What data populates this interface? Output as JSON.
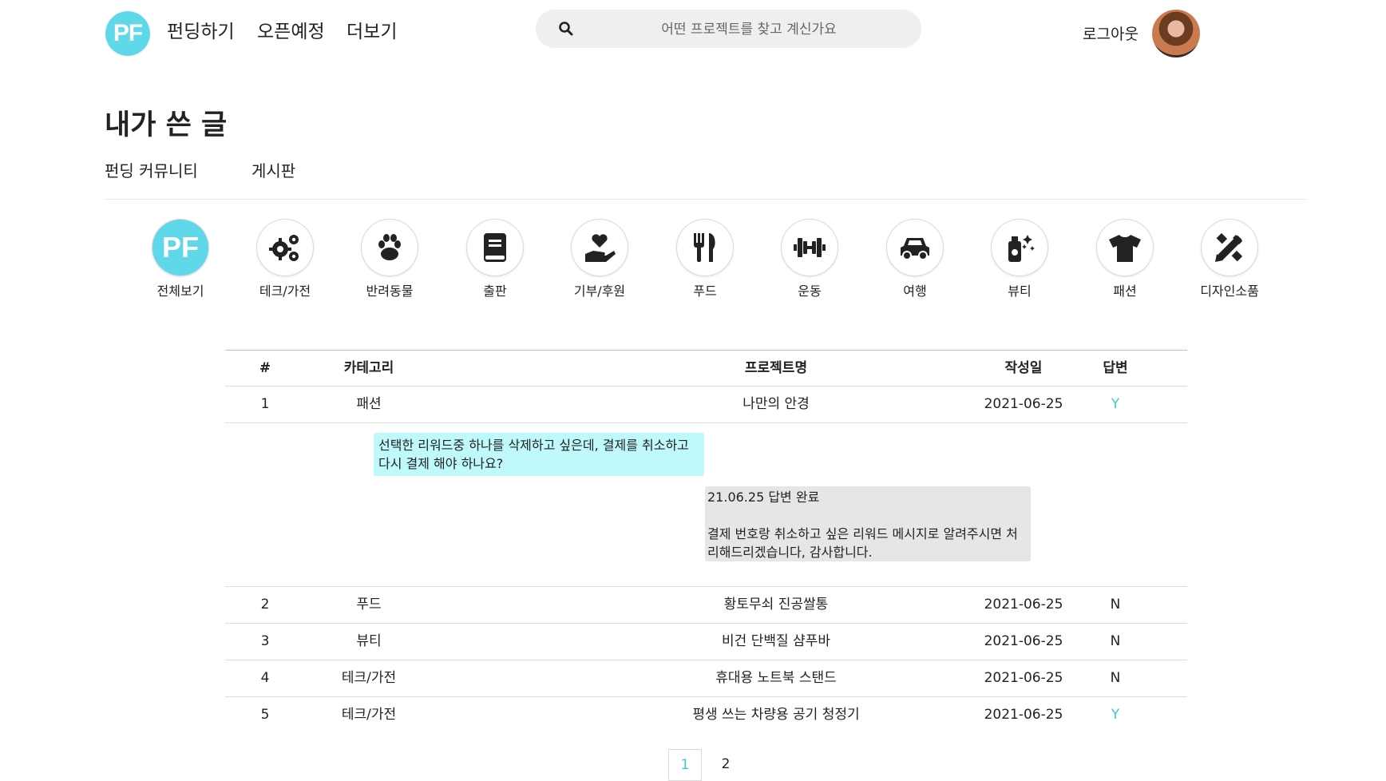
{
  "header": {
    "logo_text": "PF",
    "nav": [
      "펀딩하기",
      "오픈예정",
      "더보기"
    ],
    "search_placeholder": "어떤 프로젝트를 찾고 계신가요",
    "logout_label": "로그아웃"
  },
  "page": {
    "title": "내가 쓴 글",
    "tabs": [
      "펀딩 커뮤니티",
      "게시판"
    ]
  },
  "categories": [
    {
      "label": "전체보기",
      "icon": "pf-logo-icon"
    },
    {
      "label": "테크/가전",
      "icon": "gears-icon"
    },
    {
      "label": "반려동물",
      "icon": "paw-icon"
    },
    {
      "label": "출판",
      "icon": "book-icon"
    },
    {
      "label": "기부/후원",
      "icon": "hand-heart-icon"
    },
    {
      "label": "푸드",
      "icon": "utensils-icon"
    },
    {
      "label": "운동",
      "icon": "dumbbell-icon"
    },
    {
      "label": "여행",
      "icon": "car-icon"
    },
    {
      "label": "뷰티",
      "icon": "spray-bottle-icon"
    },
    {
      "label": "패션",
      "icon": "tshirt-icon"
    },
    {
      "label": "디자인소품",
      "icon": "pencil-ruler-icon"
    }
  ],
  "table": {
    "headers": [
      "#",
      "카테고리",
      "프로젝트명",
      "작성일",
      "답변"
    ],
    "rows": [
      {
        "num": "1",
        "category": "패션",
        "project": "나만의 안경",
        "date": "2021-06-25",
        "answer": "Y"
      },
      {
        "num": "2",
        "category": "푸드",
        "project": "황토무쇠 진공쌀통",
        "date": "2021-06-25",
        "answer": "N"
      },
      {
        "num": "3",
        "category": "뷰티",
        "project": "비건 단백질 샴푸바",
        "date": "2021-06-25",
        "answer": "N"
      },
      {
        "num": "4",
        "category": "테크/가전",
        "project": "휴대용 노트북 스탠드",
        "date": "2021-06-25",
        "answer": "N"
      },
      {
        "num": "5",
        "category": "테크/가전",
        "project": "평생 쓰는 차량용 공기 청정기",
        "date": "2021-06-25",
        "answer": "Y"
      }
    ],
    "expanded": {
      "question_lines": [
        "선택한 리워드중 하나를 삭제하고 싶은데, 결제를 취소하고",
        "다시 결제 해야 하나요?"
      ],
      "answer_status": "21.06.25 답변 완료",
      "answer_lines": [
        "결제 번호랑 취소하고 싶은 리워드 메시지로 알려주시면 처",
        "리해드리겠습니다, 감사합니다."
      ]
    }
  },
  "pagination": [
    "1",
    "2"
  ],
  "colors": {
    "accent": "#5fd9ea",
    "answer_yes": "#3fc7d9",
    "question_bg": "#bff9fc",
    "answer_bg": "#e6e6e6"
  }
}
